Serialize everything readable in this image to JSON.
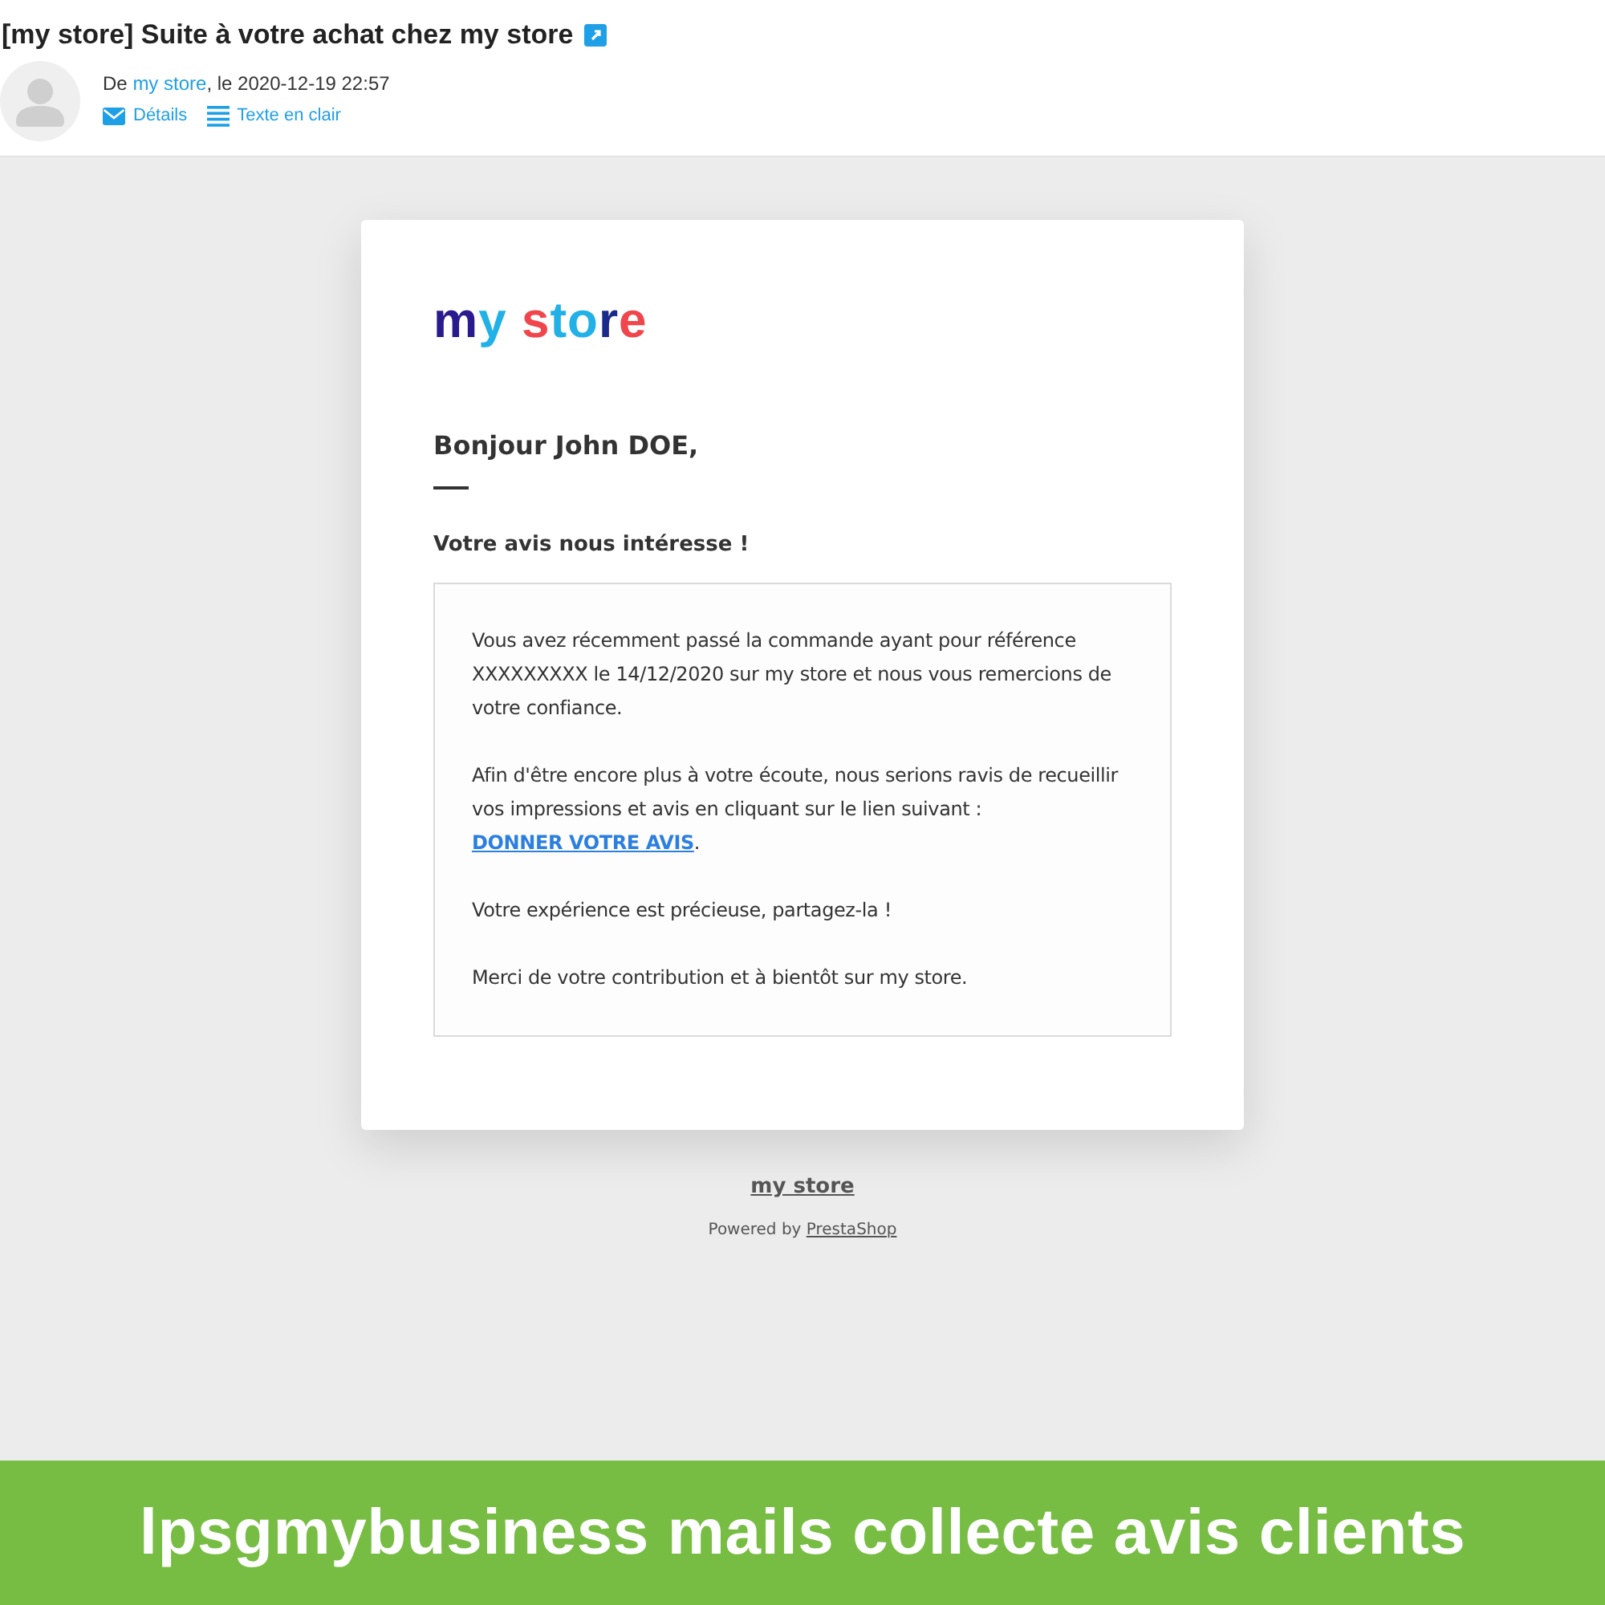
{
  "message": {
    "subject": "[my store] Suite à votre achat chez my store",
    "sender_line": {
      "before": "De ",
      "link": "my store",
      "after": ", le 2020-12-19 22:57"
    },
    "actions": [
      {
        "kind": "details",
        "label": "Détails"
      },
      {
        "kind": "plaintext",
        "label": "Texte en clair"
      }
    ]
  },
  "email": {
    "logo": "my store",
    "greeting": "Bonjour John DOE,",
    "heading": "Votre avis nous intéresse !",
    "paragraphs": [
      {
        "text": "Vous avez récemment passé la commande ayant pour référence XXXXXXXXX le 14/12/2020 sur my store et nous vous remercions de votre confiance."
      },
      {
        "text": "Afin d'être encore plus à votre écoute, nous serions ravis de recueillir vos impressions et avis en cliquant sur le lien suivant : ",
        "link": "DONNER VOTRE AVIS",
        "after": "."
      },
      {
        "text": "Votre expérience est précieuse, partagez-la !"
      },
      {
        "text": "Merci de votre contribution et à bientôt sur my store."
      }
    ],
    "footer": {
      "store_link": "my store",
      "powered_before": "Powered by ",
      "powered_link": "PrestaShop"
    }
  },
  "banner": {
    "text": "lpsgmybusiness mails collecte avis clients"
  }
}
